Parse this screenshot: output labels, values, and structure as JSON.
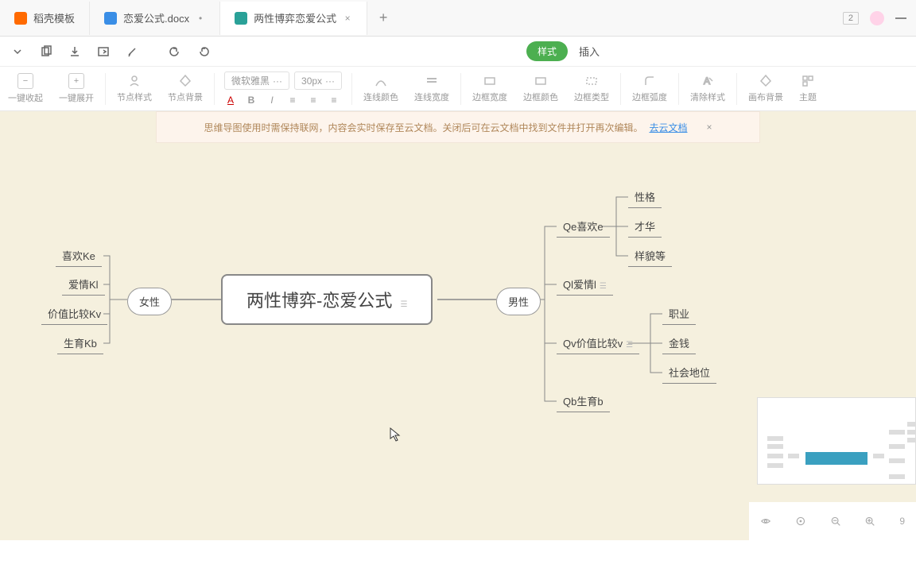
{
  "tabs": [
    {
      "label": "稻壳模板",
      "iconColor": "icon-orange"
    },
    {
      "label": "恋爱公式.docx",
      "iconColor": "icon-blue"
    },
    {
      "label": "两性博弈恋爱公式",
      "iconColor": "icon-teal"
    }
  ],
  "tabRight": {
    "badge": "2"
  },
  "menu": {
    "pill": "样式",
    "insert": "插入"
  },
  "toolbar": {
    "collapse": "一键收起",
    "expand": "一键展开",
    "nodeStyle": "节点样式",
    "nodeBg": "节点背景",
    "fontFamily": "微软雅黑",
    "fontSize": "30px",
    "lineColor": "连线颜色",
    "lineWidth": "连线宽度",
    "borderWidth": "边框宽度",
    "borderColor": "边框颜色",
    "borderType": "边框类型",
    "borderRadius": "边框弧度",
    "clearStyle": "清除样式",
    "canvasBg": "画布背景",
    "theme": "主题"
  },
  "banner": {
    "text": "思维导图使用时需保持联网，内容会实时保存至云文档。关闭后可在云文档中找到文件并打开再次编辑。",
    "link": "去云文档"
  },
  "chart_data": {
    "type": "mindmap",
    "center": "两性博弈-恋爱公式",
    "left": {
      "branch": "女性",
      "children": [
        "喜欢Ke",
        "爱情Kl",
        "价值比较Kv",
        "生育Kb"
      ]
    },
    "right": {
      "branch": "男性",
      "children": [
        {
          "label": "Qe喜欢e",
          "children": [
            "性格",
            "才华",
            "样貌等"
          ]
        },
        {
          "label": "Ql爱情l",
          "children": []
        },
        {
          "label": "Qv价值比较v",
          "children": [
            "职业",
            "金钱",
            "社会地位"
          ]
        },
        {
          "label": "Qb生育b",
          "children": []
        }
      ]
    }
  },
  "zoom": {
    "value": "9"
  }
}
